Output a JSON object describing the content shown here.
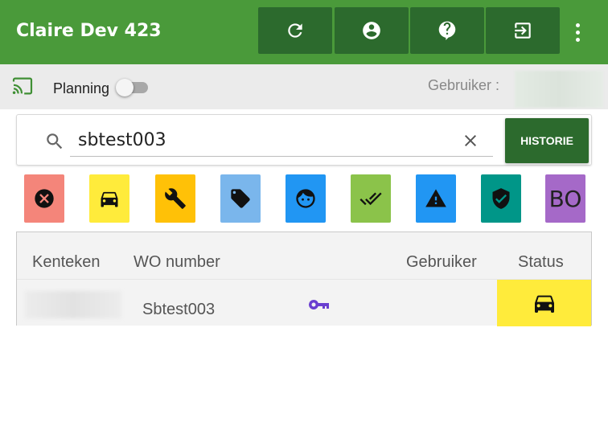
{
  "header": {
    "title": "Claire Dev 423",
    "background": "#4a9a3a",
    "button_bg": "#2c6a2d",
    "buttons": [
      {
        "icon": "refresh-icon"
      },
      {
        "icon": "account-icon"
      },
      {
        "icon": "help-icon"
      },
      {
        "icon": "logout-icon"
      }
    ],
    "menu_icon": "more-vert-icon"
  },
  "subbar": {
    "cast_icon": "cast-icon",
    "planning_label": "Planning",
    "planning_enabled": false,
    "gebruiker_label": "Gebruiker :"
  },
  "search": {
    "value": "sbtest003",
    "search_icon": "search-icon",
    "clear_icon": "close-icon",
    "historie_label": "HISTORIE"
  },
  "filters": [
    {
      "name": "cancelled",
      "icon": "cancel-icon",
      "color": "#f4857a"
    },
    {
      "name": "vehicle",
      "icon": "car-icon",
      "color": "#ffeb3b"
    },
    {
      "name": "repair",
      "icon": "wrench-icon",
      "color": "#ffc107"
    },
    {
      "name": "label",
      "icon": "tag-icon",
      "color": "#7ab6ec"
    },
    {
      "name": "customer",
      "icon": "face-icon",
      "color": "#2196f3"
    },
    {
      "name": "done",
      "icon": "done-all-icon",
      "color": "#8bc34a"
    },
    {
      "name": "warning",
      "icon": "warning-icon",
      "color": "#2196f3"
    },
    {
      "name": "verified",
      "icon": "shield-check-icon",
      "color": "#009688"
    },
    {
      "name": "bo",
      "label": "BO",
      "color": "#a569c8"
    }
  ],
  "table": {
    "headers": {
      "kenteken": "Kenteken",
      "wo_number": "WO number",
      "gebruiker": "Gebruiker",
      "status": "Status"
    },
    "rows": [
      {
        "wo_number": "Sbtest003",
        "key_icon": "key-icon",
        "key_color": "#6a3fd0",
        "status_icon": "car-icon",
        "status_color": "#ffeb3b"
      }
    ]
  }
}
